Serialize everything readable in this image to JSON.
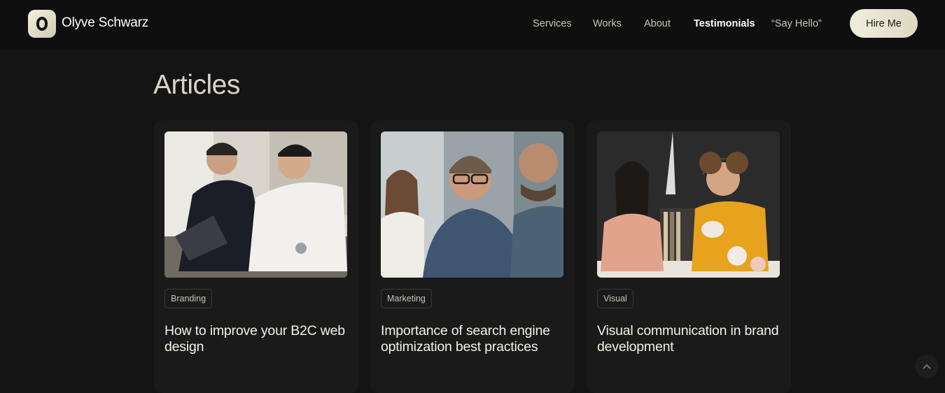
{
  "header": {
    "brand_name": "Olyve Schwarz",
    "logo_icon": "rounded-o-icon",
    "nav": [
      {
        "label": "Services",
        "active": false
      },
      {
        "label": "Works",
        "active": false
      },
      {
        "label": "About",
        "active": false
      },
      {
        "label": "Testimonials",
        "active": true
      },
      {
        "label": "“Say Hello”",
        "active": false
      }
    ],
    "cta_label": "Hire Me"
  },
  "articles": {
    "section_title": "Articles",
    "cards": [
      {
        "tag": "Branding",
        "title": "How to improve your B2C web design",
        "image": "two men reviewing a tablet"
      },
      {
        "tag": "Marketing",
        "title": "Importance of search engine optimization best practices",
        "image": "team meeting with man in glasses"
      },
      {
        "tag": "Visual",
        "title": "Visual communication in brand development",
        "image": "two designers discussing objects"
      }
    ]
  },
  "scroll_top_icon": "chevron-up-icon",
  "colors": {
    "background": "#141414",
    "accent": "#ebe7d4"
  }
}
